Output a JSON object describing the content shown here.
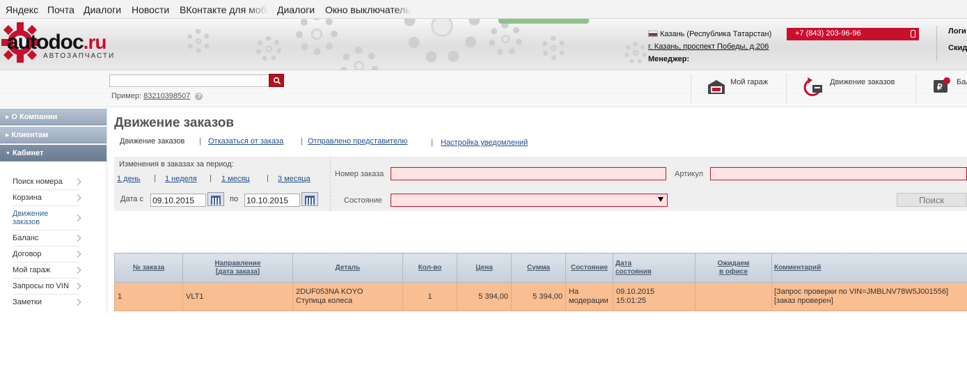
{
  "bookmarks": [
    "Яндекс",
    "Почта",
    "Диалоги",
    "Новости",
    "ВКонтакте для моби",
    "Диалоги",
    "Окно выключатель"
  ],
  "header": {
    "logo_word": "autodoc",
    "logo_tld": ".ru",
    "logo_sub": "АВТОЗАПЧАСТИ",
    "region": "Казань (Республика Татарстан)",
    "address": "г. Казань, проспект Победы, д.206",
    "manager_label": "Менеджер:",
    "phone": "+7 (843) 203-96-96",
    "login": "Логи",
    "discount": "Скид"
  },
  "search": {
    "placeholder": "",
    "example_label": "Пример:",
    "example_number": "83210398507",
    "help": "?"
  },
  "tools": {
    "garage": "Мой гараж",
    "orders": "Движение заказов",
    "balance": "Бал"
  },
  "sidebar": {
    "sections": [
      "О Компании",
      "Клиентам",
      "Кабинет"
    ],
    "items": [
      "Поиск номера",
      "Корзина",
      "Движение заказов",
      "Баланс",
      "Договор",
      "Мой гараж",
      "Запросы по VIN",
      "Заметки"
    ]
  },
  "page": {
    "title": "Движение заказов",
    "tabs": [
      "Движение заказов",
      "Отказаться от заказа",
      "Отправлено представителю",
      "Настройка уведомлений"
    ],
    "separator": "|"
  },
  "filter": {
    "period_label": "Изменения в заказах за период:",
    "periods": [
      "1 день",
      "1 неделя",
      "1 месяц",
      "3 месяца"
    ],
    "date_from_label": "Дата с",
    "date_from": "09.10.2015",
    "date_to_label": "по",
    "date_to": "10.10.2015",
    "order_number_label": "Номер заказа",
    "article_label": "Артикул",
    "status_label": "Состояние",
    "search_button": "Поиск"
  },
  "table": {
    "headers": [
      "№ заказа",
      "Направление\n[дата заказа]",
      "Деталь",
      "Кол-во",
      "Цена",
      "Сумма",
      "Состояние",
      "Дата\nсостояния",
      "Ожидаем\nв офисе",
      "Комментарий"
    ],
    "rows": [
      {
        "order": "1",
        "direction": "VLT1",
        "part_code": "2DUF053NA KOYO",
        "part_name": "Ступица колеса",
        "qty": "1",
        "price": "5 394,00",
        "sum": "5 394,00",
        "status_1": "На",
        "status_2": "модерации",
        "date_1": "09.10.2015",
        "date_2": "15:01:25",
        "expected": "",
        "comment_1": "[Запрос проверки по VIN=JMBLNV78W5J001556]",
        "comment_2": "[заказ проверен]"
      }
    ]
  },
  "colors": {
    "brand_red": "#c8102e",
    "row_highlight": "#f9be92",
    "link": "#1f4e8c"
  }
}
